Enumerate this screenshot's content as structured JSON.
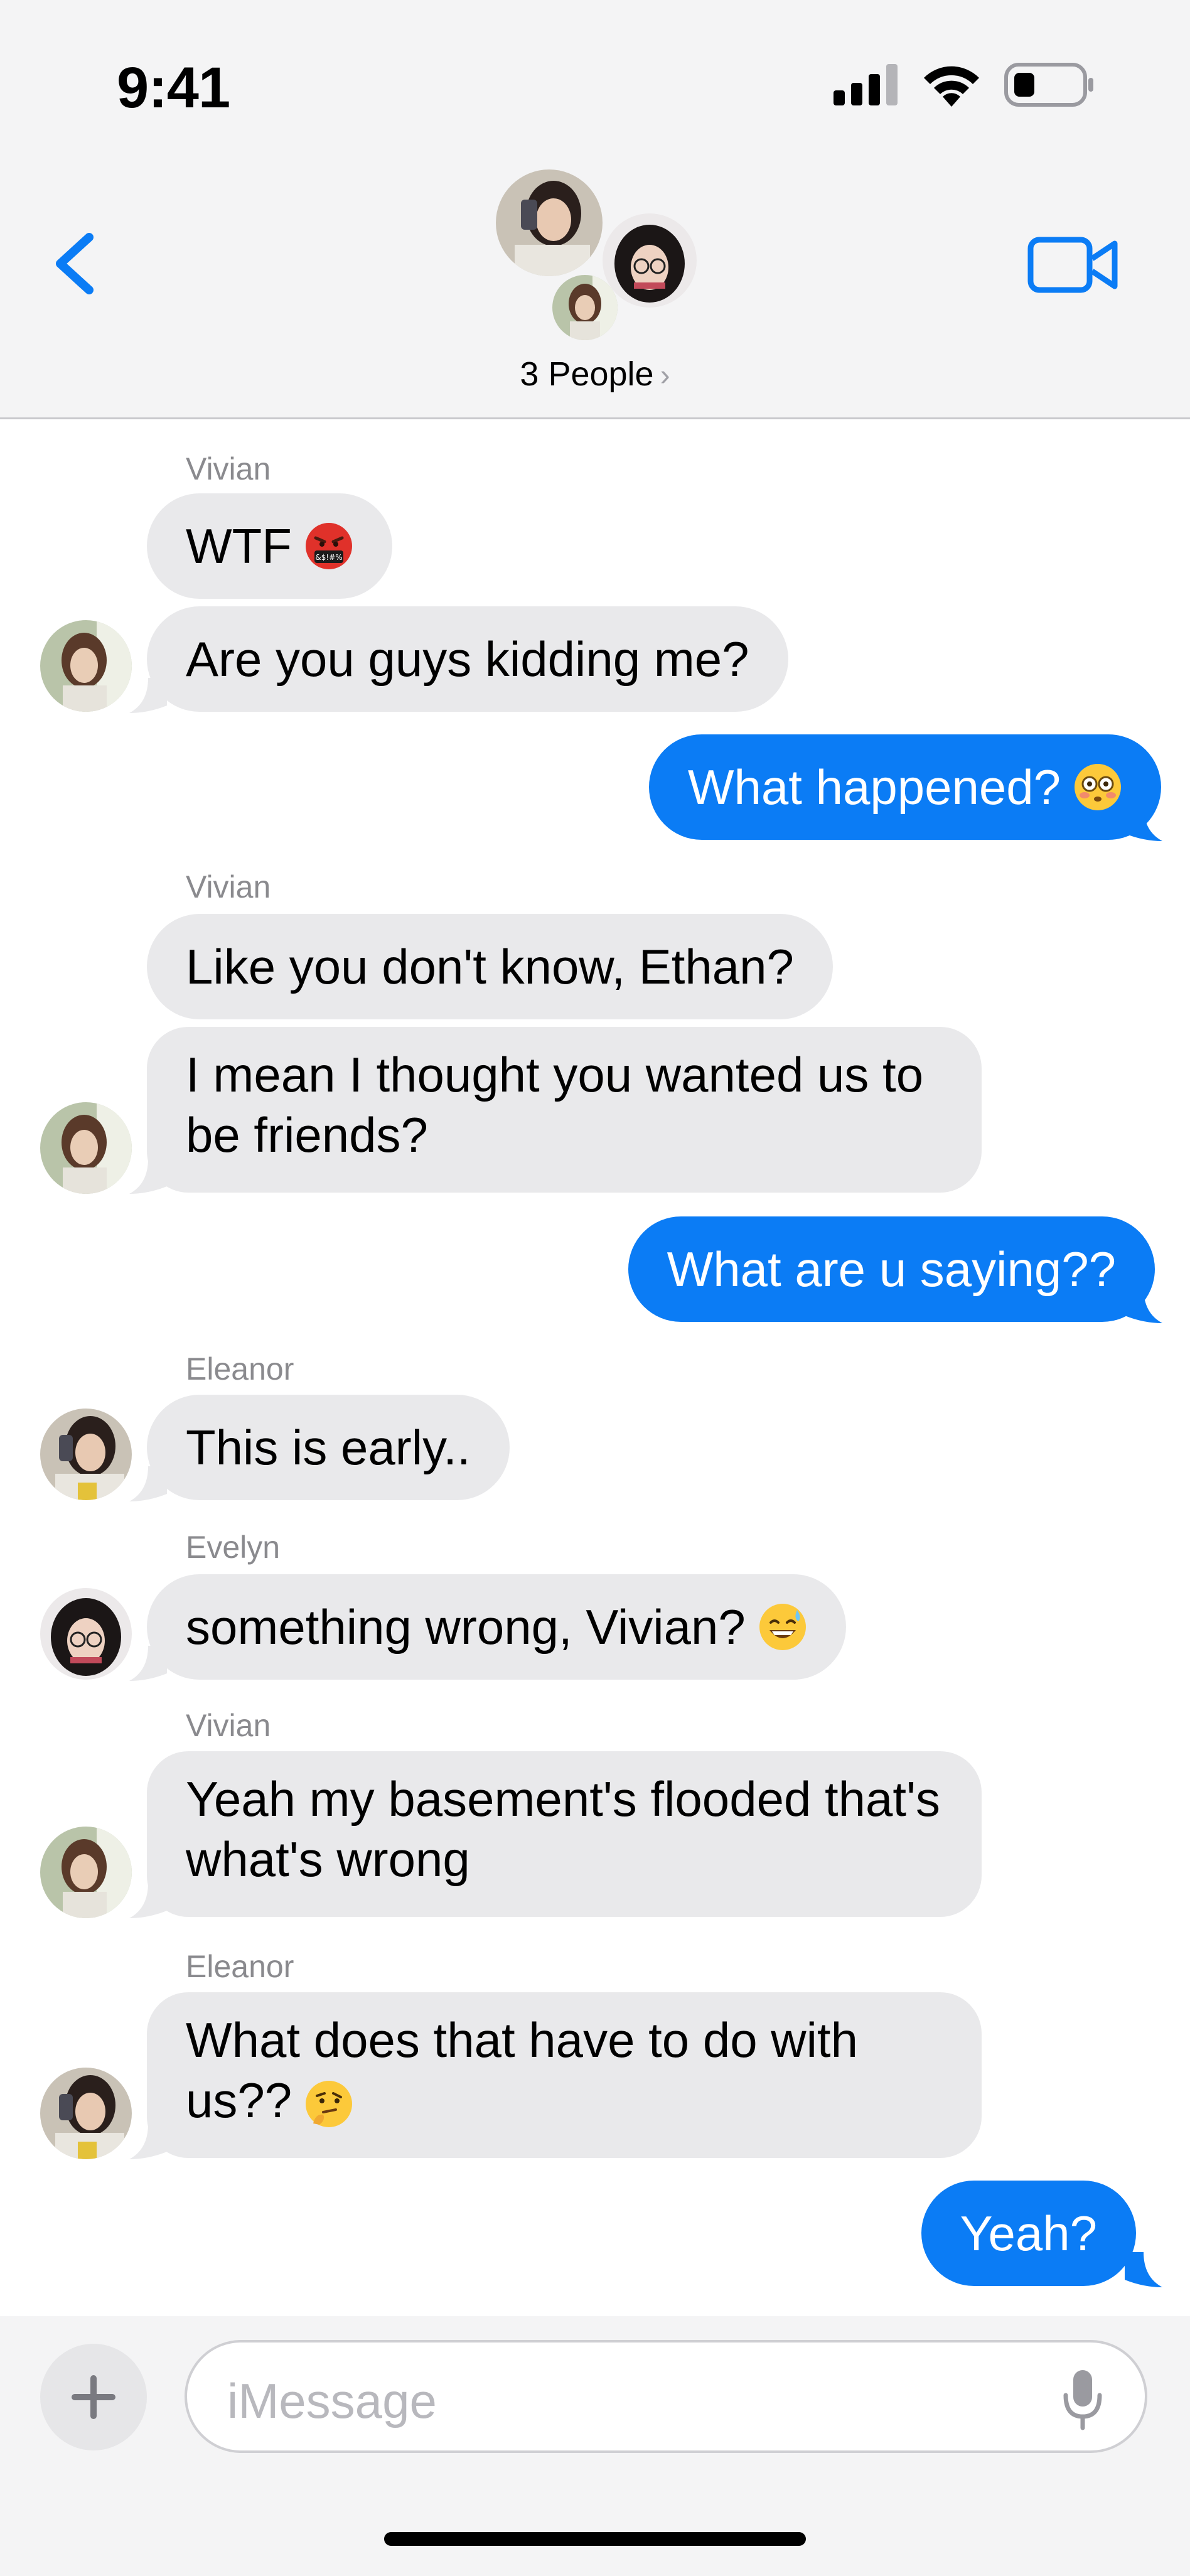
{
  "status_bar": {
    "time": "9:41",
    "icons": [
      "signal-icon",
      "wifi-icon",
      "battery-icon"
    ]
  },
  "header": {
    "back_icon": "chevron-left-icon",
    "video_icon": "video-camera-icon",
    "group_name": "3 People",
    "chevron": "›"
  },
  "colors": {
    "accent": "#0b7cf5",
    "incoming_bubble": "#e9e9eb",
    "header_bg": "#f4f4f5"
  },
  "messages": [
    {
      "id": "m1",
      "direction": "in",
      "sender": "Vivian",
      "text": "WTF",
      "emoji": "cursing-face"
    },
    {
      "id": "m2",
      "direction": "in",
      "sender": "Vivian",
      "text": "Are you guys kidding me?"
    },
    {
      "id": "m3",
      "direction": "out",
      "text": "What happened?",
      "emoji": "flushed-face"
    },
    {
      "id": "m4",
      "direction": "in",
      "sender": "Vivian",
      "text": "Like you don't know, Ethan?"
    },
    {
      "id": "m5",
      "direction": "in",
      "sender": "Vivian",
      "text": "I mean I thought you wanted us to be friends?"
    },
    {
      "id": "m6",
      "direction": "out",
      "text": "What are u saying??"
    },
    {
      "id": "m7",
      "direction": "in",
      "sender": "Eleanor",
      "text": "This is early.."
    },
    {
      "id": "m8",
      "direction": "in",
      "sender": "Evelyn",
      "text": "something wrong, Vivian?",
      "emoji": "grinning-sweat-face"
    },
    {
      "id": "m9",
      "direction": "in",
      "sender": "Vivian",
      "text": "Yeah my basement's flooded that's what's wrong"
    },
    {
      "id": "m10",
      "direction": "in",
      "sender": "Eleanor",
      "text": "What does that have to do with us??",
      "emoji": "thinking-face"
    },
    {
      "id": "m11",
      "direction": "out",
      "text": "Yeah?"
    }
  ],
  "composer": {
    "placeholder": "iMessage",
    "plus_icon": "plus-icon",
    "mic_icon": "microphone-icon"
  }
}
